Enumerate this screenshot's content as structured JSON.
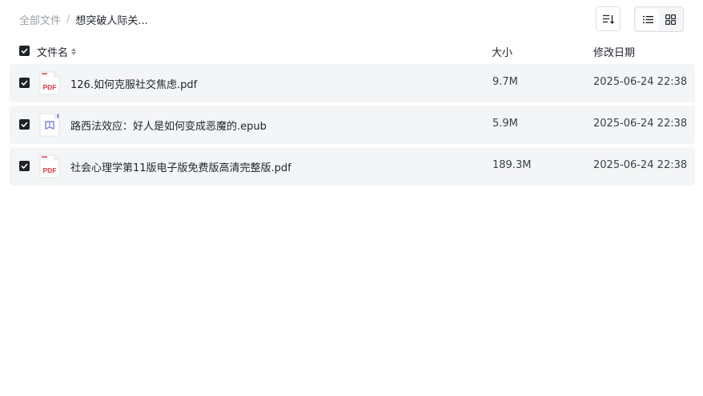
{
  "breadcrumb": {
    "root": "全部文件",
    "separator": "/",
    "current": "想突破人际关..."
  },
  "toolbar": {
    "sort_icon": "sort-icon",
    "list_view_icon": "list-view-icon",
    "grid_view_icon": "grid-view-icon",
    "active_view": "list"
  },
  "table": {
    "columns": {
      "name": "文件名",
      "size": "大小",
      "modified": "修改日期"
    },
    "select_all_checked": true,
    "rows": [
      {
        "name": "126.如何克服社交焦虑.pdf",
        "size": "9.7M",
        "modified": "2025-06-24 22:38",
        "type": "pdf",
        "icon_label": "PDF",
        "checked": true
      },
      {
        "name": "路西法效应：好人是如何变成恶魔的.epub",
        "size": "5.9M",
        "modified": "2025-06-24 22:38",
        "type": "epub",
        "checked": true
      },
      {
        "name": "社会心理学第11版电子版免费版高清完整版.pdf",
        "size": "189.3M",
        "modified": "2025-06-24 22:38",
        "type": "pdf",
        "icon_label": "PDF",
        "checked": true
      }
    ]
  },
  "colors": {
    "pdf_red": "#e8383d",
    "epub_purple": "#7b7fe0",
    "row_bg": "#f4f5f6",
    "checkbox": "#1f2329"
  }
}
